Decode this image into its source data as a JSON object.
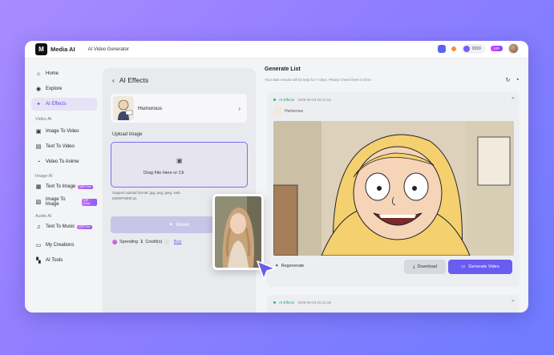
{
  "app": {
    "logo": "M",
    "brand": "Media AI",
    "tool_title": "AI Video Generator"
  },
  "topbar": {
    "credits": "9999",
    "vip": "VIP"
  },
  "sidebar": {
    "home": "Home",
    "explore": "Explore",
    "ai_effects": "AI Effects",
    "video_ai_label": "Video AI",
    "image_to_video": "Image To Video",
    "text_to_video": "Text To Video",
    "video_to_anime": "Video To Anime",
    "image_ai_label": "Image AI",
    "text_to_image": "Text To Image",
    "image_to_image": "Image To Image",
    "audio_ai_label": "Audio AI",
    "text_to_music": "Text To Music",
    "my_creations": "My Creations",
    "ai_tools": "AI Tools",
    "vip_free_badge": "VIP Free"
  },
  "effects_panel": {
    "title": "AI Effects",
    "effect_name": "Humorous",
    "upload_label": "Upload Image",
    "upload_text": "Drag File Here or Cli",
    "upload_hint_line1": "Support upload format: jpg, png, jpeg, web",
    "upload_hint_line2": "≤6000*6000 px.",
    "generate_label": "Gener",
    "spending_prefix": "Spending",
    "spending_count": "1",
    "spending_suffix": "Credit(s)",
    "buy": "Buy"
  },
  "generate_list": {
    "title": "Generate List",
    "subtitle": "Your task results will be kept for 7 days. Please check them in time.",
    "task1": {
      "tag": "AI Effects",
      "timestamp": "2025-06-03 15:41:52",
      "effect": "Humorous",
      "regenerate": "Regenerate",
      "download": "Download",
      "generate_video": "Generate Video"
    },
    "task2": {
      "tag": "AI Effects",
      "timestamp": "2025-06-03 15:41:35"
    }
  },
  "colors": {
    "accent": "#6a5cf0",
    "active_bg": "#e5e3f5",
    "success": "#2eb872"
  }
}
